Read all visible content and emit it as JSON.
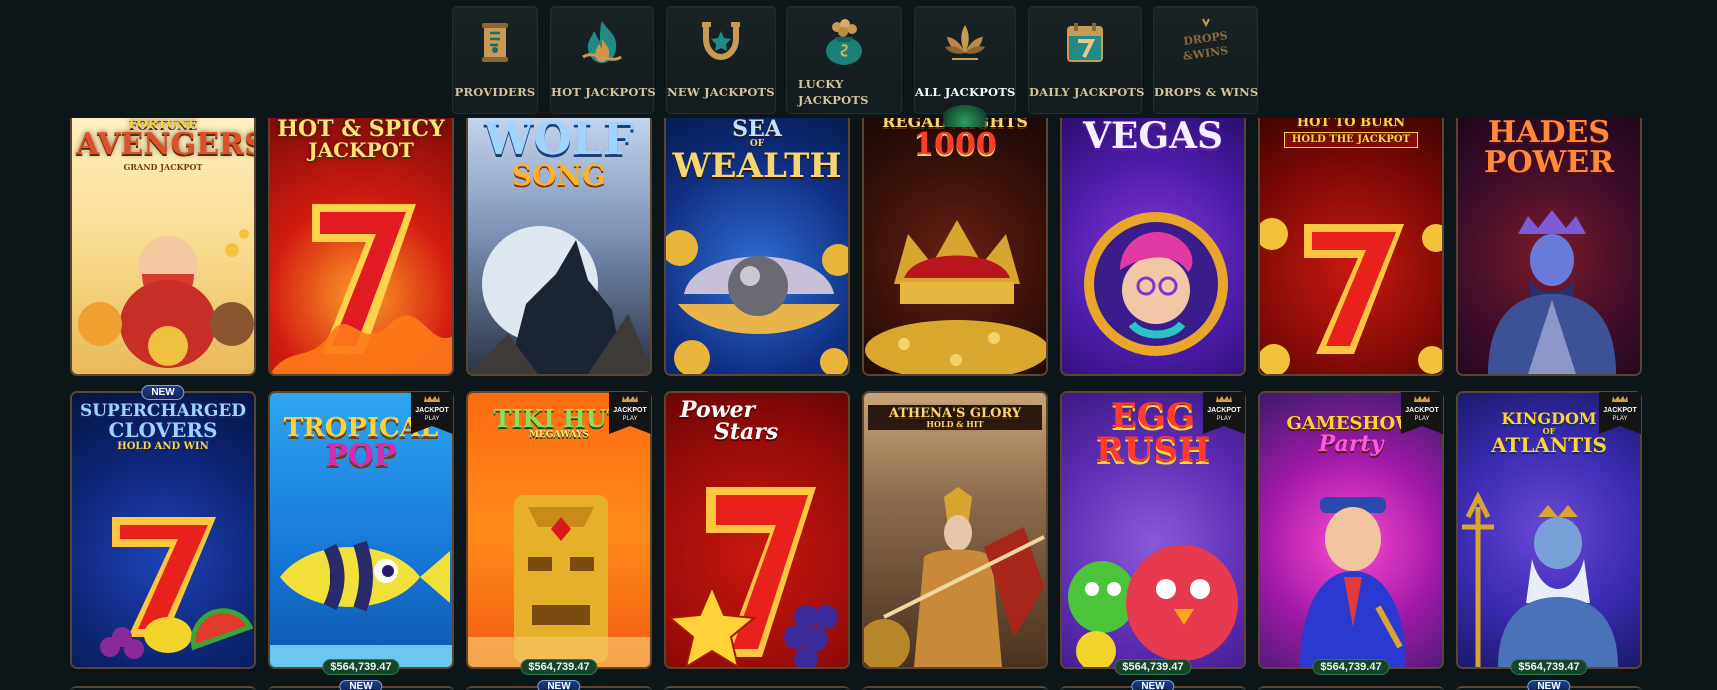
{
  "nav": {
    "items": [
      {
        "label": "PROVIDERS",
        "icon": "scroll-icon"
      },
      {
        "label": "HOT JACKPOTS",
        "icon": "flame-icon"
      },
      {
        "label": "NEW JACKPOTS",
        "icon": "horseshoe-star-icon"
      },
      {
        "label": "LUCKY JACKPOTS",
        "icon": "coin-bag-icon"
      },
      {
        "label": "ALL JACKPOTS",
        "icon": "lotus-icon",
        "active": true
      },
      {
        "label": "DAILY JACKPOTS",
        "icon": "calendar-seven-icon"
      },
      {
        "label": "DROPS & WINS",
        "icon": "drops-wins-logo-icon"
      }
    ]
  },
  "badges": {
    "new": "NEW",
    "jackpot_play_l1": "JACKPOT",
    "jackpot_play_l2": "PLAY",
    "prize_amount": "$564,739.47"
  },
  "games_row1": [
    {
      "title_l1": "FORTUNE",
      "title_l2": "AVENGERS",
      "sub": "GRAND JACKPOT"
    },
    {
      "title_l1": "HOT & SPICY",
      "title_l2": "JACKPOT"
    },
    {
      "title_l1": "WOLF",
      "title_l2": "SONG"
    },
    {
      "title_l1": "SEA",
      "title_l2": "WEALTH",
      "sub": "OF"
    },
    {
      "title_l1": "REGAL MIGHTS",
      "title_l2": "1000"
    },
    {
      "title_l1": "",
      "title_l2": "VEGAS"
    },
    {
      "title_l1": "HOT TO BURN",
      "title_l2": "HOLD THE JACKPOT"
    },
    {
      "title_l1": "HADES",
      "title_l2": "POWER"
    }
  ],
  "games_row2": [
    {
      "title_l1": "SUPERCHARGED",
      "title_l2": "CLOVERS",
      "sub": "HOLD AND WIN"
    },
    {
      "title_l1": "TROPICAL",
      "title_l2": "POP"
    },
    {
      "title_l1": "TIKI HUT",
      "title_l2": "MEGAWAYS"
    },
    {
      "title_l1": "Power",
      "title_l2": "Stars"
    },
    {
      "title_l1": "ATHENA'S GLORY",
      "title_l2": "HOLD & HIT"
    },
    {
      "title_l1": "EGG",
      "title_l2": "RUSH"
    },
    {
      "title_l1": "GAMESHOW",
      "title_l2": "Party"
    },
    {
      "title_l1": "KINGDOM",
      "title_l2": "ATLANTIS",
      "sub": "OF"
    }
  ]
}
